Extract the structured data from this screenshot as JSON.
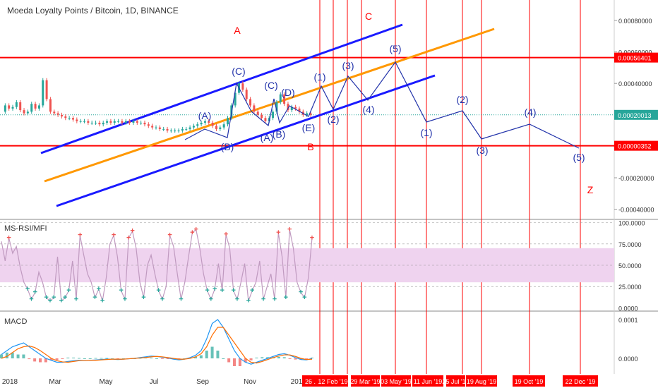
{
  "header": {
    "title": "Moeda Loyalty Points / Bitcoin, 1D, BINANCE"
  },
  "indicators": {
    "rsi_label": "MS-RSI/MFI",
    "macd_label": "MACD"
  },
  "colors": {
    "up": "#26a69a",
    "down": "#ef5350",
    "blue": "#1a1aff",
    "orange": "#ff9800",
    "red": "#ff0000",
    "rsi_band": "#efd3ef",
    "rsi_line": "#c09ac0",
    "wave": "#2233aa"
  },
  "chart_data": [
    {
      "type": "line",
      "pane": "price",
      "yaxis": {
        "ticks": [
          "0.00080000",
          "0.00060000",
          "0.00040000",
          "0.00020000",
          "0.00000000",
          "-0.00020000",
          "-0.00040000"
        ],
        "tick_values": [
          0.0008,
          0.0006,
          0.0004,
          0.0002,
          0.0,
          -0.0002,
          -0.0004
        ],
        "ylim": [
          -0.00046,
          0.00093
        ]
      },
      "price_labels": [
        {
          "text": "0.00056401",
          "value": 0.000564,
          "color": "#ff0000"
        },
        {
          "text": "0.00020013",
          "value": 0.0002,
          "color": "#26a69a"
        },
        {
          "text": "0.00000352",
          "value": 3.5e-06,
          "color": "#ff0000"
        }
      ],
      "series": [
        {
          "values": [
            0.00022,
            0.00026,
            0.00024,
            0.00025,
            0.00028,
            0.00023,
            0.00021,
            0.00022,
            0.00027,
            0.00024,
            0.00026,
            0.00042,
            0.0003,
            0.00022,
            0.00021,
            0.0002,
            0.00019,
            0.00018,
            0.00018,
            0.00017,
            0.00016,
            0.00016,
            0.00016,
            0.00015,
            0.00015,
            0.00015,
            0.00014,
            0.00015,
            0.00016,
            0.00015,
            0.00016,
            0.00016,
            0.00015,
            0.00016,
            0.00015,
            0.00016,
            0.00015,
            0.00015,
            0.00014,
            0.00013,
            0.00012,
            0.00012,
            0.00011,
            0.00011,
            0.0001,
            0.0001,
            0.0001,
            0.0001,
            0.00011,
            0.00011,
            0.00012,
            0.00013,
            0.00014,
            0.00015,
            0.00016,
            0.00015,
            0.00013,
            0.00011,
            0.00012,
            0.00014,
            0.00018,
            0.00026,
            0.00034,
            0.0004,
            0.00036,
            0.0003,
            0.00026,
            0.00022,
            0.0002,
            0.00018,
            0.00016,
            0.00018,
            0.00022,
            0.00028,
            0.00033,
            0.00027,
            0.00023,
            0.00025,
            0.00024,
            0.00022,
            0.0002,
            0.00021,
            0.0002
          ]
        }
      ],
      "channel_lines": [
        {
          "name": "",
          "color": "blue",
          "points": [
            [
              0.0
            ],
            [
              0.0
            ]
          ]
        }
      ],
      "wave_labels": [
        "A",
        "C",
        "B",
        "Z",
        "(A)",
        "(B)",
        "(C)",
        "(A)",
        "(B)",
        "(C)",
        "(D)",
        "(E)",
        "(1)",
        "(2)",
        "(3)",
        "(4)",
        "(5)",
        "(1)",
        "(2)",
        "(3)",
        "(4)",
        "(5)"
      ],
      "xaxis": {
        "ticks": [
          "2018",
          "Mar",
          "May",
          "Jul",
          "Sep",
          "Nov",
          "201"
        ]
      },
      "date_labels": [
        "26 .",
        "12 Feb '19",
        "29 Mar '19",
        "03 May '19",
        "11 Jun '19",
        "25 Jul '19",
        "19 Aug '19",
        "19 Oct '19",
        "22 Dec '19"
      ]
    },
    {
      "type": "line",
      "pane": "rsi",
      "yaxis": {
        "ticks": [
          "100.0000",
          "75.0000",
          "50.0000",
          "25.0000",
          "0.0000"
        ],
        "tick_values": [
          100,
          75,
          50,
          25,
          0
        ],
        "ylim": [
          -3,
          103
        ]
      },
      "band": [
        30,
        70
      ],
      "series": [
        {
          "name": "",
          "values": [
            78,
            55,
            82,
            64,
            72,
            48,
            30,
            22,
            10,
            18,
            42,
            30,
            12,
            8,
            12,
            60,
            8,
            12,
            20,
            55,
            10,
            85,
            62,
            40,
            30,
            12,
            22,
            8,
            35,
            75,
            85,
            60,
            20,
            10,
            82,
            90,
            70,
            30,
            12,
            50,
            62,
            40,
            20,
            10,
            25,
            85,
            72,
            40,
            10,
            30,
            60,
            88,
            92,
            70,
            40,
            20,
            10,
            22,
            52,
            20,
            86,
            70,
            20,
            10,
            30,
            52,
            8,
            20,
            30,
            55,
            10,
            25,
            40,
            10,
            88,
            60,
            12,
            92,
            70,
            30,
            18,
            12,
            35,
            82
          ]
        }
      ]
    },
    {
      "type": "line",
      "pane": "macd",
      "yaxis": {
        "ticks": [
          "0.0001",
          "0.0000"
        ],
        "tick_values": [
          0.0001,
          0.0
        ],
        "ylim": [
          -4e-05,
          0.00012
        ]
      },
      "series": [
        {
          "name": "",
          "values": [
            1e-05,
            2e-05,
            3e-05,
            3.5e-05,
            4e-05,
            3e-05,
            2e-05,
            1e-05,
            0.0,
            -5e-06,
            -1e-05,
            -1e-05,
            -8e-06,
            -6e-06,
            -5e-06,
            -6e-06,
            -5e-06,
            -4e-06,
            -3e-06,
            -2e-06,
            -2e-06,
            -3e-06,
            -2e-06,
            -1e-06,
            0.0,
            2e-06,
            4e-06,
            6e-06,
            5e-06,
            3e-06,
            1e-06,
            -2e-06,
            -4e-06,
            -2e-06,
            2e-06,
            8e-06,
            2e-05,
            5e-05,
            9e-05,
            0.0001,
            8e-05,
            5e-05,
            2e-05,
            0.0,
            -1e-05,
            -1.5e-05,
            -1e-05,
            -5e-06,
            0.0,
            5e-06,
            1e-05,
            1.2e-05,
            8e-06,
            2e-06,
            -3e-06,
            -4e-06,
            0.0
          ]
        },
        {
          "name": "",
          "values": [
            0.0,
            5e-06,
            1.5e-05,
            2.5e-05,
            3e-05,
            3.2e-05,
            2.8e-05,
            2e-05,
            1e-05,
            0.0,
            -6e-06,
            -9e-06,
            -1e-05,
            -8e-06,
            -6e-06,
            -6e-06,
            -5e-06,
            -5e-06,
            -4e-06,
            -3e-06,
            -2e-06,
            -2e-06,
            -2e-06,
            -1e-06,
            0.0,
            1e-06,
            2e-06,
            4e-06,
            5e-06,
            4e-06,
            2e-06,
            0.0,
            -2e-06,
            -2e-06,
            0.0,
            4e-06,
            1.2e-05,
            3e-05,
            6e-05,
            8e-05,
            8e-05,
            6e-05,
            4e-05,
            2e-05,
            0.0,
            -1e-05,
            -1.2e-05,
            -8e-06,
            -3e-06,
            2e-06,
            6e-06,
            9e-06,
            9e-06,
            5e-06,
            0.0,
            -3e-06,
            -2e-06
          ]
        }
      ]
    }
  ]
}
